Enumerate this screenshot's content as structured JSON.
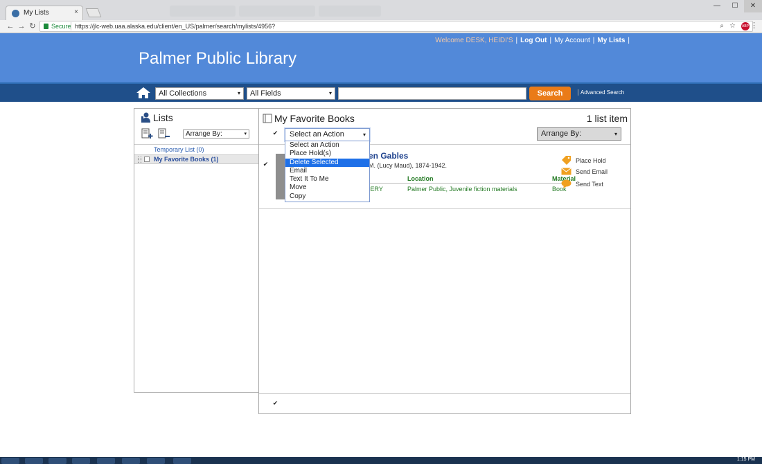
{
  "browser": {
    "tab_title": "My Lists",
    "tab_close": "×",
    "secure_label": "Secure",
    "url": "https://jlc-web.uaa.alaska.edu/client/en_US/palmer/search/mylists/4956?",
    "abp_badge": "ABP"
  },
  "header": {
    "site_title": "Palmer Public Library",
    "welcome": "Welcome DESK, HEIDI'S",
    "log_out": "Log Out",
    "my_account": "My Account",
    "my_lists": "My Lists",
    "sep": "|"
  },
  "search": {
    "collection": "All Collections",
    "field": "All Fields",
    "query": "",
    "button": "Search",
    "advanced": "Advanced Search"
  },
  "lists_panel": {
    "heading": "Lists",
    "arrange_by": "Arrange By:",
    "items": [
      {
        "label": "Temporary List (0)"
      },
      {
        "label": "My Favorite Books (1)"
      }
    ]
  },
  "main": {
    "list_title": "My Favorite Books",
    "item_count": "1 list item",
    "action_select": "Select an Action",
    "arrange_by": "Arrange By:",
    "dropdown_options": [
      "Select an Action",
      "Place Hold(s)",
      "Delete Selected",
      "Email",
      "Text It To Me",
      "Move",
      "Copy"
    ],
    "dropdown_selected_index": 2,
    "result": {
      "title": "en Gables",
      "author": "M. (Lucy Maud), 1874-1942.",
      "col_location": "Location",
      "col_material": "Material",
      "call_partial": "IERY",
      "location": "Palmer Public, Juvenile fiction materials",
      "material": "Book",
      "actions": [
        "Place Hold",
        "Send Email",
        "Send Text"
      ]
    }
  },
  "checkmark": "✔",
  "caret": "▾",
  "colors": {
    "header_blue": "#5289d9",
    "navbar_blue": "#1f4f8a",
    "search_orange": "#ea7b18",
    "link_blue": "#2a5db0",
    "green_text": "#237a23",
    "dropdown_highlight": "#1e70e8"
  },
  "icons": [
    "home-icon",
    "lists-user-icon",
    "add-list-icon",
    "remove-list-icon",
    "list-book-icon",
    "place-hold-tag-icon",
    "email-envelope-icon",
    "text-bubble-icon"
  ],
  "taskbar": {
    "clock": "1:15 PM"
  }
}
